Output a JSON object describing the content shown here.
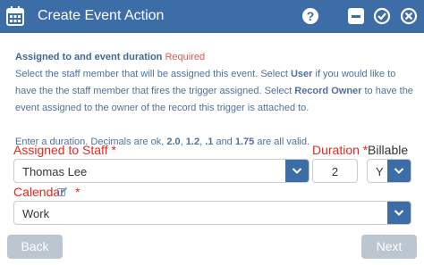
{
  "header": {
    "title": "Create Event Action",
    "background": "#3d6da7",
    "icons": [
      "calendar-icon",
      "help-icon",
      "minimize-icon",
      "confirm-icon",
      "close-icon"
    ]
  },
  "info": {
    "heading": "Assigned to and event duration",
    "required": "Required",
    "p1_a": "Select the staff member that will be assigned this event. Select ",
    "p1_user": "User",
    "p1_b": " if you would like to have the the staff member that fires the trigger assigned. Select ",
    "p1_owner": "Record Owner",
    "p1_c": " to have the event assigned to the owner of the record this trigger is attached to.",
    "p2_a": "Enter a duration. Decimals are ok, ",
    "p2_v1": "2.0",
    "p2_sep1": ", ",
    "p2_v2": "1.2",
    "p2_sep2": ", ",
    "p2_v3": ".1",
    "p2_and": " and ",
    "p2_v4": "1.75",
    "p2_b": " are all valid."
  },
  "form": {
    "staff_label": "Assigned to Staff *",
    "staff_value": "Thomas Lee",
    "duration_label": "Duration *",
    "duration_value": "2",
    "billable_label": "Billable",
    "billable_value": "Y",
    "calendar_label": "Calendar",
    "calendar_star": "*",
    "calendar_value": "Work",
    "label_color": "#e0281e"
  },
  "footer": {
    "back_label": "Back",
    "next_label": "Next"
  }
}
